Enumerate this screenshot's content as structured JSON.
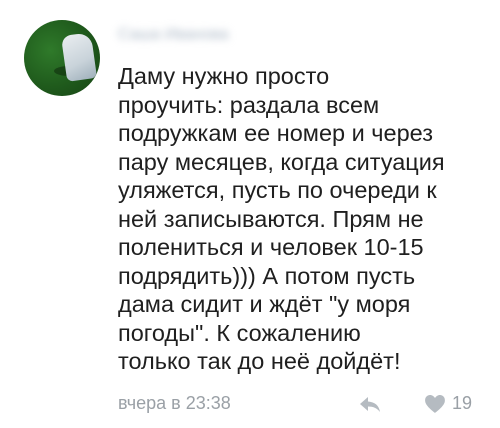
{
  "comment": {
    "author_name": "Саша Иванова",
    "text": "Даму нужно просто\nпроучить: раздала всем\nподружкам ее номер и через\nпару месяцев, когда ситуация\nуляжется, пусть по очереди к\nней записываются. Прям не\nполениться и человек 10-15\nподрядить))) А потом пусть\nдама сидит и ждёт \"у моря\nпогоды\". К сожалению\nтолько так до неё дойдёт!",
    "timestamp": "вчера в 23:38",
    "likes_count": "19",
    "reply_icon": "reply-arrow-icon",
    "like_icon": "heart-icon"
  },
  "colors": {
    "text": "#1f1f1f",
    "meta": "#9aa0a6",
    "icon": "#b5bbc1"
  }
}
